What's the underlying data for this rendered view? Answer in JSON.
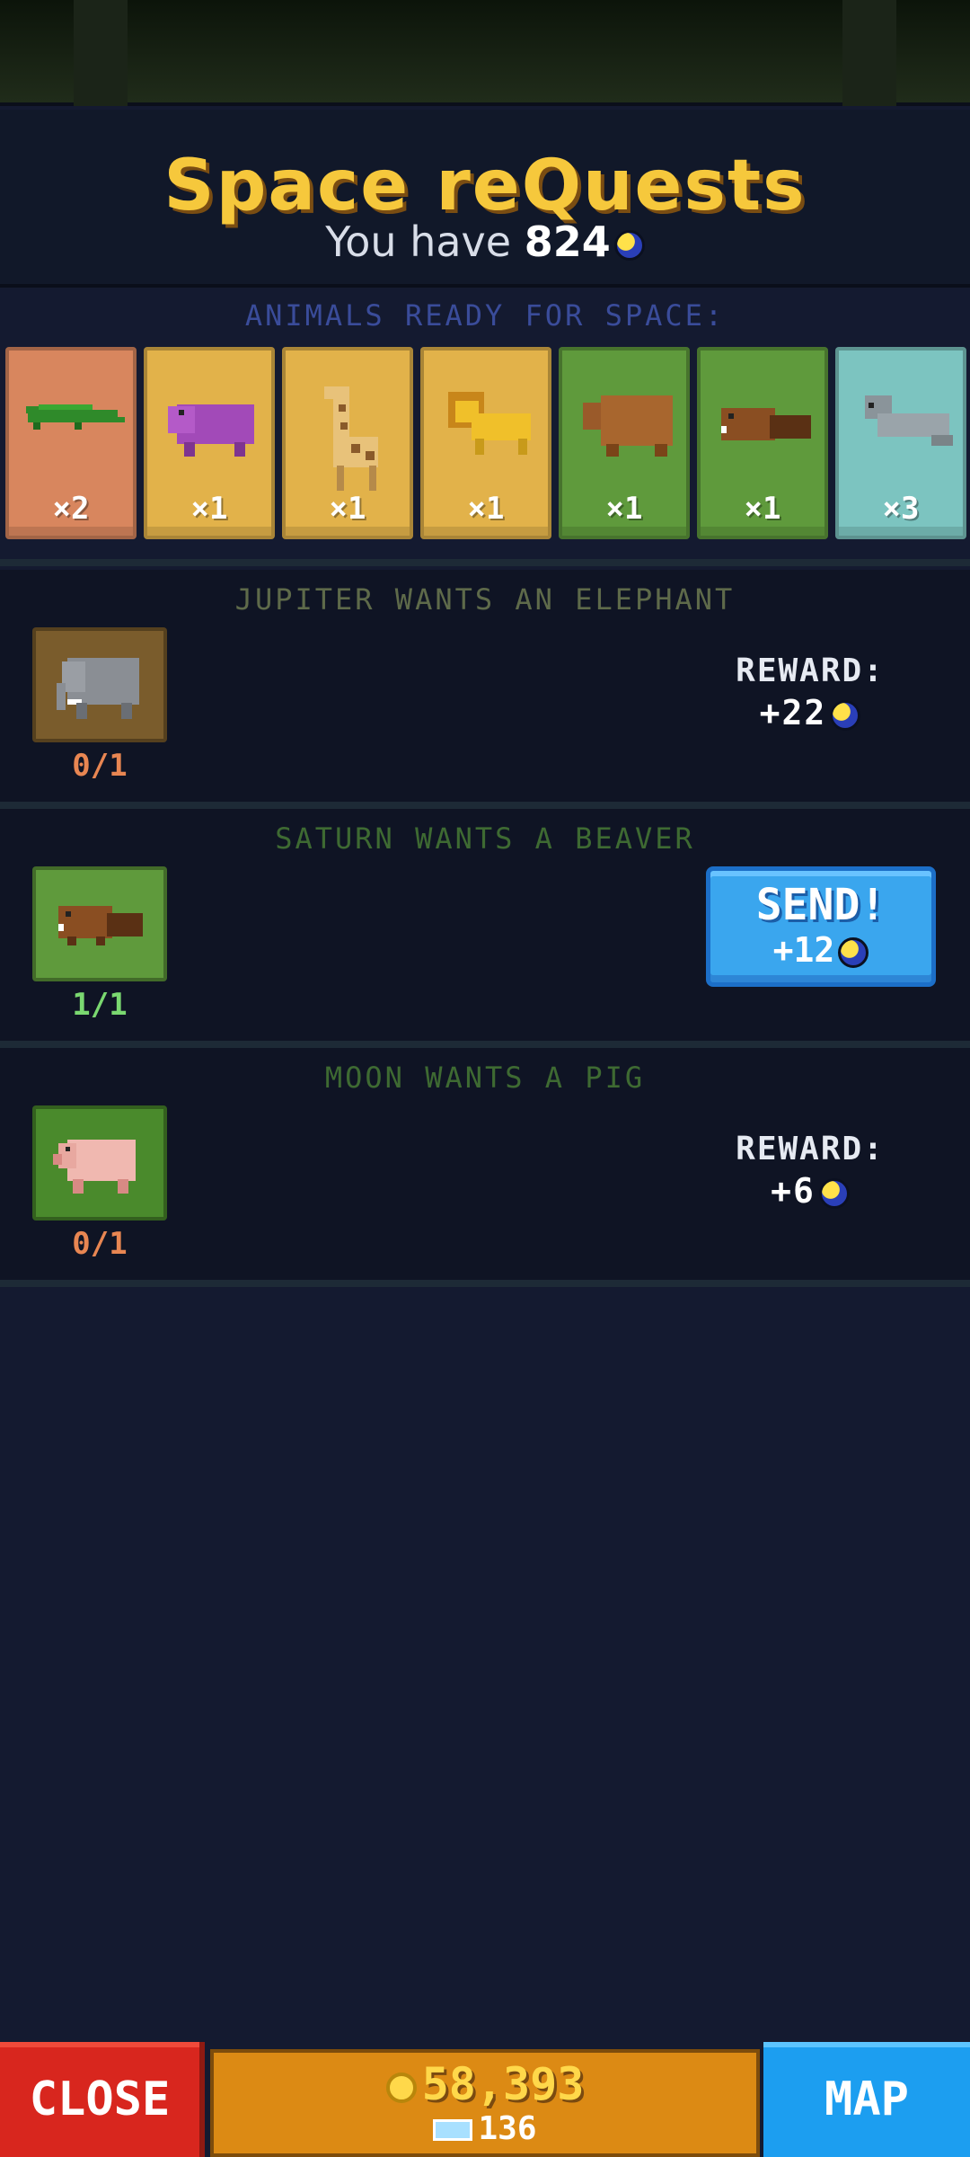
{
  "header": {
    "title": "Space reQuests",
    "you_have_prefix": "You have",
    "currency_amount": "824",
    "currency_icon": "space-coin-icon"
  },
  "ready": {
    "label": "ANIMALS READY FOR SPACE:",
    "animals": [
      {
        "icon": "crocodile-icon",
        "count": "×2",
        "bg": "#d8865e"
      },
      {
        "icon": "hippo-icon",
        "count": "×1",
        "bg": "#e2b24a"
      },
      {
        "icon": "giraffe-icon",
        "count": "×1",
        "bg": "#e2b24a"
      },
      {
        "icon": "lion-icon",
        "count": "×1",
        "bg": "#e2b24a"
      },
      {
        "icon": "bear-icon",
        "count": "×1",
        "bg": "#5f9a3c"
      },
      {
        "icon": "beaver-icon",
        "count": "×1",
        "bg": "#5f9a3c"
      },
      {
        "icon": "seal-icon",
        "count": "×3",
        "bg": "#7cc4c0"
      }
    ]
  },
  "requests": [
    {
      "title": "JUPITER WANTS AN ELEPHANT",
      "title_color": "#5e6a4a",
      "animal_icon": "elephant-icon",
      "tile_bg": "#7a5c2c",
      "progress": "0/1",
      "progress_color": "#e88652",
      "reward_label": "REWARD:",
      "reward_amount": "+22"
    },
    {
      "title": "SATURN WANTS A BEAVER",
      "title_color": "#3e6a32",
      "animal_icon": "beaver-icon",
      "tile_bg": "#5f9a3c",
      "progress": "1/1",
      "progress_color": "#7ad870",
      "send_label": "SEND!",
      "send_amount": "+12"
    },
    {
      "title": "MOON WANTS A PIG",
      "title_color": "#3e6a32",
      "animal_icon": "pig-icon",
      "tile_bg": "#4a8a2c",
      "progress": "0/1",
      "progress_color": "#e88652",
      "reward_label": "REWARD:",
      "reward_amount": "+6"
    }
  ],
  "footer": {
    "close_label": "CLOSE",
    "gold": "58,393",
    "gems": "136",
    "map_label": "MAP"
  }
}
